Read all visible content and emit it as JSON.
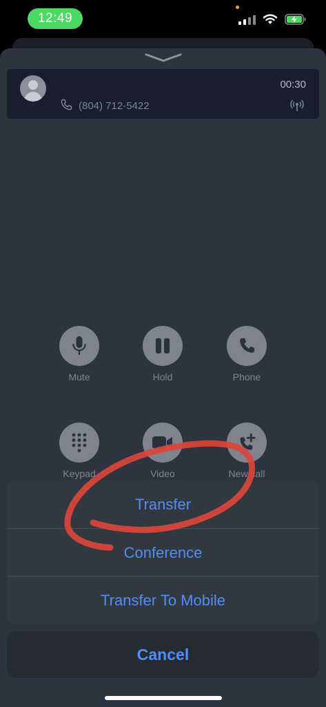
{
  "status_bar": {
    "time": "12:49"
  },
  "call": {
    "number": "(804) 712-5422",
    "timer": "00:30"
  },
  "controls": [
    {
      "label": "Mute",
      "icon": "microphone-icon"
    },
    {
      "label": "Hold",
      "icon": "pause-icon"
    },
    {
      "label": "Phone",
      "icon": "phone-icon"
    },
    {
      "label": "Keypad",
      "icon": "keypad-icon"
    },
    {
      "label": "Video",
      "icon": "video-icon"
    },
    {
      "label": "New call",
      "icon": "new-call-icon"
    }
  ],
  "action_sheet": {
    "transfer": "Transfer",
    "conference": "Conference",
    "transfer_to_mobile": "Transfer To Mobile",
    "cancel": "Cancel"
  },
  "colors": {
    "accent": "#4f8ef7",
    "time_pill": "#4cd964",
    "annotation": "#d9453a"
  }
}
